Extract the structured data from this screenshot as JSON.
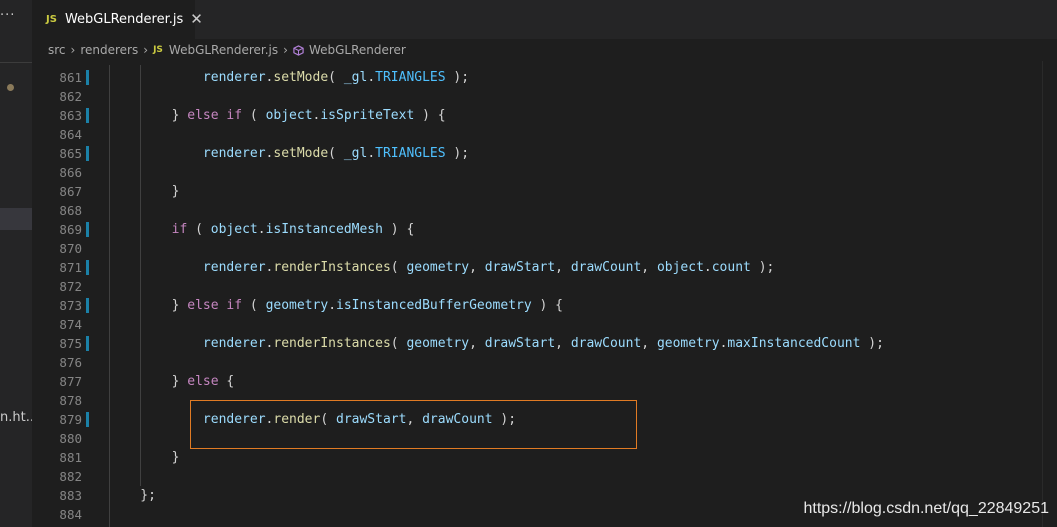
{
  "sidebar": {
    "more_label": "···",
    "file_partial": "n.ht..."
  },
  "tab": {
    "icon": "JS",
    "label": "WebGLRenderer.js",
    "close": "✕"
  },
  "breadcrumb": {
    "items": [
      "src",
      "renderers",
      "WebGLRenderer.js",
      "WebGLRenderer"
    ],
    "file_icon": "JS",
    "separator": "›",
    "symbol_icon": "class-icon"
  },
  "editor": {
    "lines": [
      {
        "n": "861",
        "mod": true,
        "code": "            renderer.setMode( _gl.TRIANGLES );"
      },
      {
        "n": "862",
        "mod": false,
        "code": ""
      },
      {
        "n": "863",
        "mod": true,
        "code": "        } else if ( object.isSpriteText ) {"
      },
      {
        "n": "864",
        "mod": false,
        "code": ""
      },
      {
        "n": "865",
        "mod": true,
        "code": "            renderer.setMode( _gl.TRIANGLES );"
      },
      {
        "n": "866",
        "mod": false,
        "code": ""
      },
      {
        "n": "867",
        "mod": false,
        "code": "        }"
      },
      {
        "n": "868",
        "mod": false,
        "code": ""
      },
      {
        "n": "869",
        "mod": true,
        "code": "        if ( object.isInstancedMesh ) {"
      },
      {
        "n": "870",
        "mod": false,
        "code": ""
      },
      {
        "n": "871",
        "mod": true,
        "code": "            renderer.renderInstances( geometry, drawStart, drawCount, object.count );"
      },
      {
        "n": "872",
        "mod": false,
        "code": ""
      },
      {
        "n": "873",
        "mod": true,
        "code": "        } else if ( geometry.isInstancedBufferGeometry ) {"
      },
      {
        "n": "874",
        "mod": false,
        "code": ""
      },
      {
        "n": "875",
        "mod": true,
        "code": "            renderer.renderInstances( geometry, drawStart, drawCount, geometry.maxInstancedCount );"
      },
      {
        "n": "876",
        "mod": false,
        "code": ""
      },
      {
        "n": "877",
        "mod": false,
        "code": "        } else {"
      },
      {
        "n": "878",
        "mod": false,
        "code": ""
      },
      {
        "n": "879",
        "mod": true,
        "code": "            renderer.render( drawStart, drawCount );"
      },
      {
        "n": "880",
        "mod": false,
        "code": ""
      },
      {
        "n": "881",
        "mod": false,
        "code": "        }"
      },
      {
        "n": "882",
        "mod": false,
        "code": ""
      },
      {
        "n": "883",
        "mod": false,
        "code": "    };"
      },
      {
        "n": "884",
        "mod": false,
        "code": ""
      }
    ]
  },
  "watermark": "https://blog.csdn.net/qq_22849251",
  "colors": {
    "background": "#1e1e1e",
    "gutter_modified": "#1b81a8",
    "highlight_border": "#e07b24",
    "js_icon": "#cbcb41"
  }
}
